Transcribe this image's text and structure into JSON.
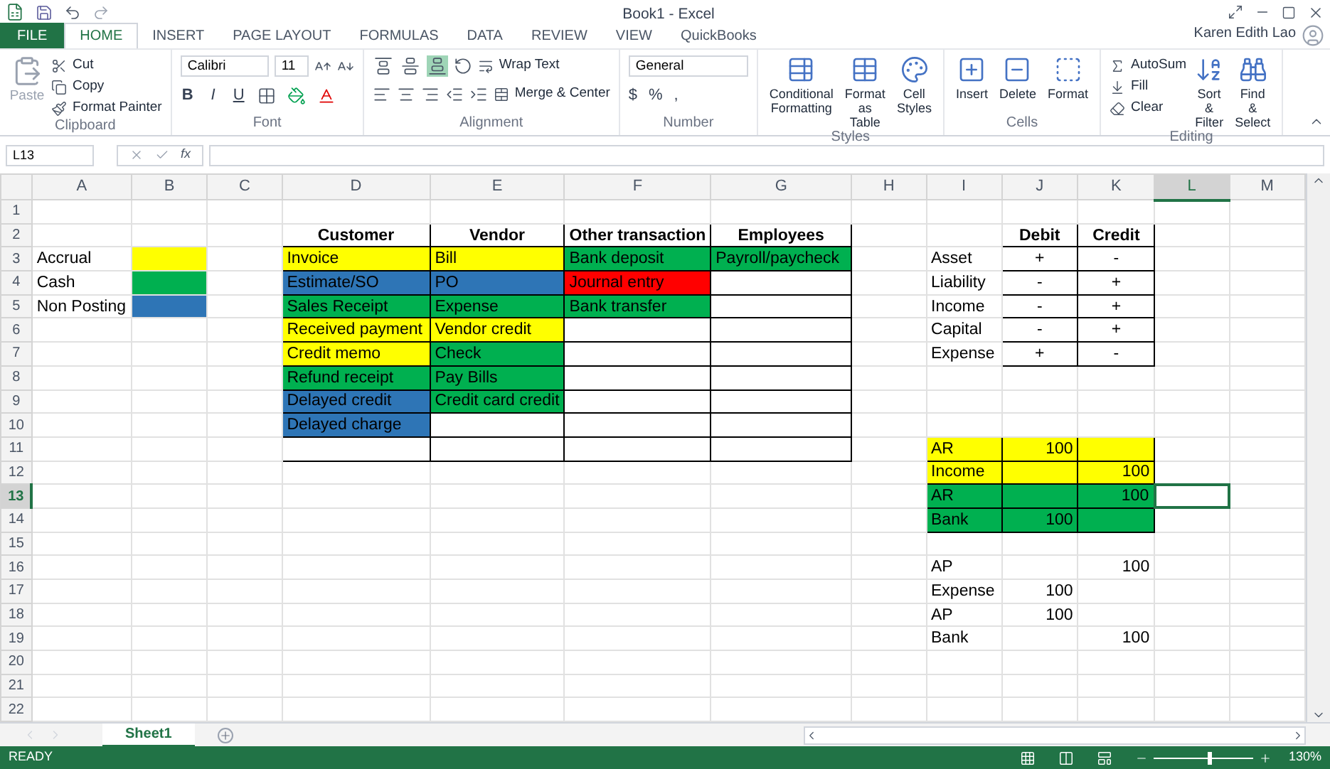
{
  "window": {
    "title": "Book1 - Excel",
    "user": "Karen Edith Lao"
  },
  "tabs": [
    {
      "label": "FILE",
      "kind": "file",
      "selected": false
    },
    {
      "label": "HOME",
      "kind": "tab",
      "selected": true
    },
    {
      "label": "INSERT",
      "kind": "tab",
      "selected": false
    },
    {
      "label": "PAGE LAYOUT",
      "kind": "tab",
      "selected": false
    },
    {
      "label": "FORMULAS",
      "kind": "tab",
      "selected": false
    },
    {
      "label": "DATA",
      "kind": "tab",
      "selected": false
    },
    {
      "label": "REVIEW",
      "kind": "tab",
      "selected": false
    },
    {
      "label": "VIEW",
      "kind": "tab",
      "selected": false
    },
    {
      "label": "QuickBooks",
      "kind": "tab",
      "selected": false
    }
  ],
  "ribbon": [
    {
      "kind": "clipboard",
      "label": "Clipboard",
      "paste": "Paste",
      "items": [
        "Cut",
        "Copy",
        "Format Painter"
      ]
    },
    {
      "kind": "font",
      "label": "Font",
      "font_name": "Calibri",
      "font_size": "11",
      "styles": [
        "B",
        "I",
        "U"
      ]
    },
    {
      "kind": "alignment",
      "label": "Alignment",
      "wrap": "Wrap Text",
      "merge": "Merge & Center",
      "vertical_align": [
        {
          "selected": false
        },
        {
          "selected": false
        },
        {
          "selected": true
        }
      ]
    },
    {
      "kind": "number",
      "label": "Number",
      "format": "General",
      "symbols": [
        "$",
        "%",
        ","
      ]
    },
    {
      "kind": "large",
      "label": "Styles",
      "buttons": [
        "Conditional Formatting",
        "Format as Table",
        "Cell Styles"
      ]
    },
    {
      "kind": "large",
      "label": "Cells",
      "buttons": [
        "Insert",
        "Delete",
        "Format"
      ]
    },
    {
      "kind": "editing",
      "label": "Editing",
      "small": [
        "AutoSum",
        "Fill",
        "Clear"
      ],
      "buttons": [
        "Sort & Filter",
        "Find & Select"
      ]
    }
  ],
  "formula_bar": {
    "name_box": "L13",
    "function_label": "fx"
  },
  "columns": [
    {
      "label": "A",
      "selected": false
    },
    {
      "label": "B",
      "selected": false
    },
    {
      "label": "C",
      "selected": false
    },
    {
      "label": "D",
      "selected": false
    },
    {
      "label": "E",
      "selected": false
    },
    {
      "label": "F",
      "selected": false
    },
    {
      "label": "G",
      "selected": false
    },
    {
      "label": "H",
      "selected": false
    },
    {
      "label": "I",
      "selected": false
    },
    {
      "label": "J",
      "selected": false
    },
    {
      "label": "K",
      "selected": false
    },
    {
      "label": "L",
      "selected": true
    },
    {
      "label": "M",
      "selected": false
    }
  ],
  "rows": [
    {
      "label": "1",
      "selected": false,
      "cells": [
        {},
        {},
        {},
        {},
        {},
        {},
        {},
        {},
        {},
        {},
        {},
        {},
        {}
      ]
    },
    {
      "label": "2",
      "selected": false,
      "cells": [
        {},
        {},
        {},
        {
          "text": "Customer",
          "kind": "header",
          "boxed": true
        },
        {
          "text": "Vendor",
          "kind": "header",
          "boxed": true
        },
        {
          "text": "Other transaction",
          "kind": "header",
          "boxed": true
        },
        {
          "text": "Employees",
          "kind": "header",
          "boxed": true
        },
        {},
        {},
        {
          "text": "Debit",
          "kind": "header",
          "boxed": true
        },
        {
          "text": "Credit",
          "kind": "header",
          "boxed": true
        },
        {},
        {}
      ]
    },
    {
      "label": "3",
      "selected": false,
      "cells": [
        {
          "text": "Accrual",
          "kind": "text"
        },
        {
          "color": "#ffff00"
        },
        {},
        {
          "text": "Invoice",
          "kind": "text",
          "color": "#ffff00",
          "boxed": true
        },
        {
          "text": "Bill",
          "kind": "text",
          "color": "#ffff00",
          "boxed": true
        },
        {
          "text": "Bank deposit",
          "kind": "text",
          "color": "#00b050",
          "boxed": true
        },
        {
          "text": "Payroll/paycheck",
          "kind": "text",
          "color": "#00b050",
          "boxed": true
        },
        {},
        {
          "text": "Asset",
          "kind": "text"
        },
        {
          "text": "+",
          "kind": "sign",
          "boxed": true
        },
        {
          "text": "-",
          "kind": "sign",
          "boxed": true
        },
        {},
        {}
      ]
    },
    {
      "label": "4",
      "selected": false,
      "cells": [
        {
          "text": "Cash",
          "kind": "text"
        },
        {
          "color": "#00b050"
        },
        {},
        {
          "text": "Estimate/SO",
          "kind": "text",
          "color": "#2e75b6",
          "boxed": true
        },
        {
          "text": "PO",
          "kind": "text",
          "color": "#2e75b6",
          "boxed": true
        },
        {
          "text": "Journal entry",
          "kind": "text",
          "color": "#ff0000",
          "boxed": true
        },
        {
          "boxed": true
        },
        {},
        {
          "text": "Liability",
          "kind": "text"
        },
        {
          "text": "-",
          "kind": "sign",
          "boxed": true
        },
        {
          "text": "+",
          "kind": "sign",
          "boxed": true
        },
        {},
        {}
      ]
    },
    {
      "label": "5",
      "selected": false,
      "cells": [
        {
          "text": "Non Posting",
          "kind": "text"
        },
        {
          "color": "#2e75b6"
        },
        {},
        {
          "text": "Sales Receipt",
          "kind": "text",
          "color": "#00b050",
          "boxed": true
        },
        {
          "text": "Expense",
          "kind": "text",
          "color": "#00b050",
          "boxed": true
        },
        {
          "text": "Bank transfer",
          "kind": "text",
          "color": "#00b050",
          "boxed": true
        },
        {
          "boxed": true
        },
        {},
        {
          "text": "Income",
          "kind": "text"
        },
        {
          "text": "-",
          "kind": "sign",
          "boxed": true
        },
        {
          "text": "+",
          "kind": "sign",
          "boxed": true
        },
        {},
        {}
      ]
    },
    {
      "label": "6",
      "selected": false,
      "cells": [
        {},
        {},
        {},
        {
          "text": "Received payment",
          "kind": "text",
          "color": "#ffff00",
          "boxed": true
        },
        {
          "text": "Vendor credit",
          "kind": "text",
          "color": "#ffff00",
          "boxed": true
        },
        {
          "boxed": true
        },
        {
          "boxed": true
        },
        {},
        {
          "text": "Capital",
          "kind": "text"
        },
        {
          "text": "-",
          "kind": "sign",
          "boxed": true
        },
        {
          "text": "+",
          "kind": "sign",
          "boxed": true
        },
        {},
        {}
      ]
    },
    {
      "label": "7",
      "selected": false,
      "cells": [
        {},
        {},
        {},
        {
          "text": "Credit memo",
          "kind": "text",
          "color": "#ffff00",
          "boxed": true
        },
        {
          "text": "Check",
          "kind": "text",
          "color": "#00b050",
          "boxed": true
        },
        {
          "boxed": true
        },
        {
          "boxed": true
        },
        {},
        {
          "text": "Expense",
          "kind": "text"
        },
        {
          "text": "+",
          "kind": "sign",
          "boxed": true
        },
        {
          "text": "-",
          "kind": "sign",
          "boxed": true
        },
        {},
        {}
      ]
    },
    {
      "label": "8",
      "selected": false,
      "cells": [
        {},
        {},
        {},
        {
          "text": "Refund receipt",
          "kind": "text",
          "color": "#00b050",
          "boxed": true
        },
        {
          "text": "Pay Bills",
          "kind": "text",
          "color": "#00b050",
          "boxed": true
        },
        {
          "boxed": true
        },
        {
          "boxed": true
        },
        {},
        {},
        {},
        {},
        {},
        {}
      ]
    },
    {
      "label": "9",
      "selected": false,
      "cells": [
        {},
        {},
        {},
        {
          "text": "Delayed credit",
          "kind": "text",
          "color": "#2e75b6",
          "boxed": true
        },
        {
          "text": "Credit card credit",
          "kind": "text",
          "color": "#00b050",
          "boxed": true
        },
        {
          "boxed": true
        },
        {
          "boxed": true
        },
        {},
        {},
        {},
        {},
        {},
        {}
      ]
    },
    {
      "label": "10",
      "selected": false,
      "cells": [
        {},
        {},
        {},
        {
          "text": "Delayed charge",
          "kind": "text",
          "color": "#2e75b6",
          "boxed": true
        },
        {
          "boxed": true
        },
        {
          "boxed": true
        },
        {
          "boxed": true
        },
        {},
        {},
        {},
        {},
        {},
        {}
      ]
    },
    {
      "label": "11",
      "selected": false,
      "cells": [
        {},
        {},
        {},
        {
          "boxed": true
        },
        {
          "boxed": true
        },
        {
          "boxed": true
        },
        {
          "boxed": true
        },
        {},
        {
          "text": "AR",
          "kind": "text",
          "color": "#ffff00",
          "boxed": true
        },
        {
          "text": "100",
          "kind": "number",
          "color": "#ffff00",
          "boxed": true
        },
        {
          "color": "#ffff00",
          "boxed": true
        },
        {},
        {}
      ]
    },
    {
      "label": "12",
      "selected": false,
      "cells": [
        {},
        {},
        {},
        {},
        {},
        {},
        {},
        {},
        {
          "text": "Income",
          "kind": "text",
          "color": "#ffff00",
          "boxed": true
        },
        {
          "color": "#ffff00",
          "boxed": true
        },
        {
          "text": "100",
          "kind": "number",
          "color": "#ffff00",
          "boxed": true
        },
        {},
        {}
      ]
    },
    {
      "label": "13",
      "selected": true,
      "cells": [
        {},
        {},
        {},
        {},
        {},
        {},
        {},
        {},
        {
          "text": "AR",
          "kind": "text",
          "color": "#00b050",
          "boxed": true
        },
        {
          "color": "#00b050",
          "boxed": true
        },
        {
          "text": "100",
          "kind": "number",
          "color": "#00b050",
          "boxed": true
        },
        {},
        {}
      ]
    },
    {
      "label": "14",
      "selected": false,
      "cells": [
        {},
        {},
        {},
        {},
        {},
        {},
        {},
        {},
        {
          "text": "Bank",
          "kind": "text",
          "color": "#00b050",
          "boxed": true
        },
        {
          "text": "100",
          "kind": "number",
          "color": "#00b050",
          "boxed": true
        },
        {
          "color": "#00b050",
          "boxed": true
        },
        {},
        {}
      ]
    },
    {
      "label": "15",
      "selected": false,
      "cells": [
        {},
        {},
        {},
        {},
        {},
        {},
        {},
        {},
        {},
        {},
        {},
        {},
        {}
      ]
    },
    {
      "label": "16",
      "selected": false,
      "cells": [
        {},
        {},
        {},
        {},
        {},
        {},
        {},
        {},
        {
          "text": "AP",
          "kind": "text"
        },
        {},
        {
          "text": "100",
          "kind": "number"
        },
        {},
        {}
      ]
    },
    {
      "label": "17",
      "selected": false,
      "cells": [
        {},
        {},
        {},
        {},
        {},
        {},
        {},
        {},
        {
          "text": "Expense",
          "kind": "text"
        },
        {
          "text": "100",
          "kind": "number"
        },
        {},
        {},
        {}
      ]
    },
    {
      "label": "18",
      "selected": false,
      "cells": [
        {},
        {},
        {},
        {},
        {},
        {},
        {},
        {},
        {
          "text": "AP",
          "kind": "text"
        },
        {
          "text": "100",
          "kind": "number"
        },
        {},
        {},
        {}
      ]
    },
    {
      "label": "19",
      "selected": false,
      "cells": [
        {},
        {},
        {},
        {},
        {},
        {},
        {},
        {},
        {
          "text": "Bank",
          "kind": "text"
        },
        {},
        {
          "text": "100",
          "kind": "number"
        },
        {},
        {}
      ]
    },
    {
      "label": "20",
      "selected": false,
      "cells": [
        {},
        {},
        {},
        {},
        {},
        {},
        {},
        {},
        {},
        {},
        {},
        {},
        {}
      ]
    },
    {
      "label": "21",
      "selected": false,
      "cells": [
        {},
        {},
        {},
        {},
        {},
        {},
        {},
        {},
        {},
        {},
        {},
        {},
        {}
      ]
    },
    {
      "label": "22",
      "selected": false,
      "cells": [
        {},
        {},
        {},
        {},
        {},
        {},
        {},
        {},
        {},
        {},
        {},
        {},
        {}
      ]
    }
  ],
  "sheets": [
    {
      "label": "Sheet1",
      "selected": true
    }
  ],
  "status_bar": {
    "status": "READY",
    "zoom": "130%",
    "zoom_slider": {
      "level": 0.55
    }
  }
}
